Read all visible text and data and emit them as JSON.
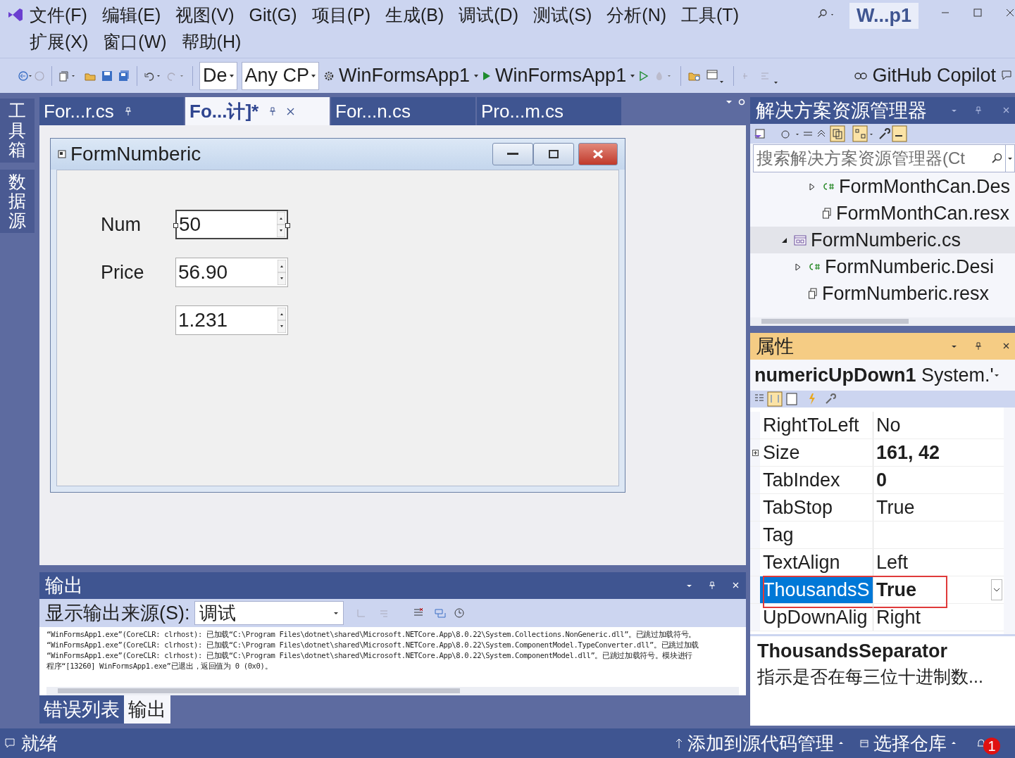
{
  "window": {
    "title": "W...p1"
  },
  "menu": [
    "文件(F)",
    "编辑(E)",
    "视图(V)",
    "Git(G)",
    "项目(P)",
    "生成(B)",
    "调试(D)",
    "测试(S)",
    "分析(N)",
    "工具(T)",
    "扩展(X)",
    "窗口(W)",
    "帮助(H)"
  ],
  "toolbar": {
    "configuration": "De",
    "platform": "Any CP",
    "startup_project": "WinFormsApp1",
    "run_target": "WinFormsApp1",
    "copilot": "GitHub Copilot"
  },
  "side_tabs": [
    "工具箱",
    "数据源"
  ],
  "editor_tabs": [
    {
      "label": "For...r.cs",
      "selected": false,
      "pinned": true
    },
    {
      "label": "Fo...计]*",
      "selected": true,
      "pinned": true
    },
    {
      "label": "For...n.cs",
      "selected": false,
      "pinned": false
    },
    {
      "label": "Pro...m.cs",
      "selected": false,
      "pinned": false
    }
  ],
  "designer": {
    "form_title": "FormNumberic",
    "controls": [
      {
        "label": "Num",
        "value": "50",
        "selected": true
      },
      {
        "label": "Price",
        "value": "56.90",
        "selected": false
      },
      {
        "value": "1.231",
        "selected": false
      }
    ]
  },
  "output": {
    "title": "输出",
    "source_label": "显示输出来源(S):",
    "source": "调试",
    "lines": [
      "“WinFormsApp1.exe”(CoreCLR: clrhost): 已加载“C:\\Program Files\\dotnet\\shared\\Microsoft.NETCore.App\\8.0.22\\System.Collections.NonGeneric.dll”。已跳过加载符号。",
      "“WinFormsApp1.exe”(CoreCLR: clrhost): 已加载“C:\\Program Files\\dotnet\\shared\\Microsoft.NETCore.App\\8.0.22\\System.ComponentModel.TypeConverter.dll”。已跳过加载",
      "“WinFormsApp1.exe”(CoreCLR: clrhost): 已加载“C:\\Program Files\\dotnet\\shared\\Microsoft.NETCore.App\\8.0.22\\System.ComponentModel.dll”。已跳过加载符号。模块进行",
      "程序“[13260] WinFormsApp1.exe”已退出，返回值为 0 (0x0)。"
    ],
    "tabs": [
      {
        "label": "错误列表",
        "selected": false
      },
      {
        "label": "输出",
        "selected": true
      }
    ]
  },
  "solution_explorer": {
    "title": "解决方案资源管理器",
    "search_placeholder": "搜索解决方案资源管理器(Ct",
    "items": [
      {
        "children": [
          {
            "label": "FormMonthCan.Des",
            "kind": "csharp",
            "expanded": false,
            "selected": false
          },
          {
            "label": "FormMonthCan.resx",
            "kind": "resource",
            "selected": false
          }
        ]
      },
      {
        "label": "FormNumberic.cs",
        "kind": "form",
        "expanded": true,
        "selected": true,
        "children": [
          {
            "label": "FormNumberic.Desi",
            "kind": "csharp",
            "expanded": false,
            "selected": false
          },
          {
            "label": "FormNumberic.resx",
            "kind": "resource",
            "selected": false
          }
        ]
      }
    ]
  },
  "properties": {
    "title": "属性",
    "object_name": "numericUpDown1",
    "object_type": "System.'",
    "rows": [
      {
        "name": "RightToLeft",
        "value": "No",
        "bold": false,
        "expandable": false,
        "selected": false,
        "outlined": false
      },
      {
        "name": "Size",
        "value": "161, 42",
        "bold": true,
        "expandable": true,
        "selected": false,
        "outlined": false
      },
      {
        "name": "TabIndex",
        "value": "0",
        "bold": true,
        "expandable": false,
        "selected": false,
        "outlined": false
      },
      {
        "name": "TabStop",
        "value": "True",
        "bold": false,
        "expandable": false,
        "selected": false,
        "outlined": false
      },
      {
        "name": "Tag",
        "expandable": false,
        "selected": false,
        "outlined": false
      },
      {
        "name": "TextAlign",
        "value": "Left",
        "bold": false,
        "expandable": false,
        "selected": false,
        "outlined": false
      },
      {
        "name": "ThousandsS",
        "value": "True",
        "bold": true,
        "expandable": false,
        "selected": true,
        "outlined": true
      },
      {
        "name": "UpDownAlig",
        "value": "Right",
        "bold": false,
        "expandable": false,
        "selected": false,
        "outlined": false
      }
    ],
    "description": {
      "title": "ThousandsSeparator",
      "text": "指示是否在每三位十进制数..."
    }
  },
  "status_bar": {
    "message": "就绪",
    "source_control": "添加到源代码管理",
    "repository": "选择仓库",
    "notifications": "1"
  }
}
